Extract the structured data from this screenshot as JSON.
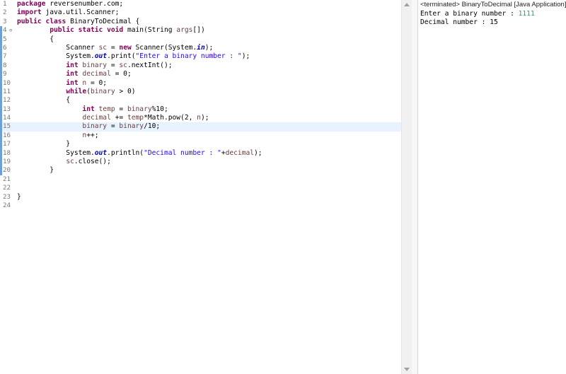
{
  "editor": {
    "lines": [
      {
        "n": "1",
        "tokens": [
          {
            "t": "kw",
            "v": "package"
          },
          {
            "t": "p",
            "v": " reversenumber.com;"
          }
        ]
      },
      {
        "n": "2",
        "tokens": [
          {
            "t": "kw",
            "v": "import"
          },
          {
            "t": "p",
            "v": " java.util.Scanner;"
          }
        ]
      },
      {
        "n": "3",
        "tokens": [
          {
            "t": "kw",
            "v": "public"
          },
          {
            "t": "p",
            "v": " "
          },
          {
            "t": "kw",
            "v": "class"
          },
          {
            "t": "p",
            "v": " BinaryToDecimal {"
          }
        ]
      },
      {
        "n": "4",
        "fold": "⊖",
        "changed": true,
        "tokens": [
          {
            "t": "p",
            "v": "        "
          },
          {
            "t": "kw",
            "v": "public"
          },
          {
            "t": "p",
            "v": " "
          },
          {
            "t": "kw",
            "v": "static"
          },
          {
            "t": "p",
            "v": " "
          },
          {
            "t": "kw",
            "v": "void"
          },
          {
            "t": "p",
            "v": " main(String "
          },
          {
            "t": "var",
            "v": "args"
          },
          {
            "t": "p",
            "v": "[])"
          }
        ]
      },
      {
        "n": "5",
        "changed": true,
        "tokens": [
          {
            "t": "p",
            "v": "        {"
          }
        ]
      },
      {
        "n": "6",
        "changed": true,
        "tokens": [
          {
            "t": "p",
            "v": "            Scanner "
          },
          {
            "t": "var",
            "v": "sc"
          },
          {
            "t": "p",
            "v": " = "
          },
          {
            "t": "kw",
            "v": "new"
          },
          {
            "t": "p",
            "v": " Scanner(System."
          },
          {
            "t": "fld",
            "v": "in"
          },
          {
            "t": "p",
            "v": ");"
          }
        ]
      },
      {
        "n": "7",
        "changed": true,
        "tokens": [
          {
            "t": "p",
            "v": "            System."
          },
          {
            "t": "fld",
            "v": "out"
          },
          {
            "t": "p",
            "v": ".print("
          },
          {
            "t": "str",
            "v": "\"Enter a binary number : \""
          },
          {
            "t": "p",
            "v": ");"
          }
        ]
      },
      {
        "n": "8",
        "changed": true,
        "tokens": [
          {
            "t": "p",
            "v": "            "
          },
          {
            "t": "kw",
            "v": "int"
          },
          {
            "t": "p",
            "v": " "
          },
          {
            "t": "var",
            "v": "binary"
          },
          {
            "t": "p",
            "v": " = "
          },
          {
            "t": "var",
            "v": "sc"
          },
          {
            "t": "p",
            "v": ".nextInt();"
          }
        ]
      },
      {
        "n": "9",
        "changed": true,
        "tokens": [
          {
            "t": "p",
            "v": "            "
          },
          {
            "t": "kw",
            "v": "int"
          },
          {
            "t": "p",
            "v": " "
          },
          {
            "t": "var",
            "v": "decimal"
          },
          {
            "t": "p",
            "v": " = 0;"
          }
        ]
      },
      {
        "n": "10",
        "changed": true,
        "tokens": [
          {
            "t": "p",
            "v": "            "
          },
          {
            "t": "kw",
            "v": "int"
          },
          {
            "t": "p",
            "v": " "
          },
          {
            "t": "var",
            "v": "n"
          },
          {
            "t": "p",
            "v": " = 0;"
          }
        ]
      },
      {
        "n": "11",
        "changed": true,
        "tokens": [
          {
            "t": "p",
            "v": "            "
          },
          {
            "t": "kw",
            "v": "while"
          },
          {
            "t": "p",
            "v": "("
          },
          {
            "t": "var",
            "v": "binary"
          },
          {
            "t": "p",
            "v": " > 0)"
          }
        ]
      },
      {
        "n": "12",
        "changed": true,
        "tokens": [
          {
            "t": "p",
            "v": "            {"
          }
        ]
      },
      {
        "n": "13",
        "changed": true,
        "tokens": [
          {
            "t": "p",
            "v": "                "
          },
          {
            "t": "kw",
            "v": "int"
          },
          {
            "t": "p",
            "v": " "
          },
          {
            "t": "var",
            "v": "temp"
          },
          {
            "t": "p",
            "v": " = "
          },
          {
            "t": "var",
            "v": "binary"
          },
          {
            "t": "p",
            "v": "%10;"
          }
        ]
      },
      {
        "n": "14",
        "changed": true,
        "tokens": [
          {
            "t": "p",
            "v": "                "
          },
          {
            "t": "var",
            "v": "decimal"
          },
          {
            "t": "p",
            "v": " += "
          },
          {
            "t": "var",
            "v": "temp"
          },
          {
            "t": "p",
            "v": "*Math."
          },
          {
            "t": "p",
            "v": "pow(2, "
          },
          {
            "t": "var",
            "v": "n"
          },
          {
            "t": "p",
            "v": ");"
          }
        ]
      },
      {
        "n": "15",
        "changed": true,
        "current": true,
        "tokens": [
          {
            "t": "p",
            "v": "                "
          },
          {
            "t": "var",
            "v": "binary"
          },
          {
            "t": "p",
            "v": " = "
          },
          {
            "t": "var",
            "v": "binary"
          },
          {
            "t": "p",
            "v": "/10;"
          }
        ]
      },
      {
        "n": "16",
        "changed": true,
        "tokens": [
          {
            "t": "p",
            "v": "                "
          },
          {
            "t": "var",
            "v": "n"
          },
          {
            "t": "p",
            "v": "++;"
          }
        ]
      },
      {
        "n": "17",
        "changed": true,
        "tokens": [
          {
            "t": "p",
            "v": "            }"
          }
        ]
      },
      {
        "n": "18",
        "changed": true,
        "tokens": [
          {
            "t": "p",
            "v": "            System."
          },
          {
            "t": "fld",
            "v": "out"
          },
          {
            "t": "p",
            "v": ".println("
          },
          {
            "t": "str",
            "v": "\"Decimal number : \""
          },
          {
            "t": "p",
            "v": "+"
          },
          {
            "t": "var",
            "v": "decimal"
          },
          {
            "t": "p",
            "v": ");"
          }
        ]
      },
      {
        "n": "19",
        "changed": true,
        "tokens": [
          {
            "t": "p",
            "v": "            "
          },
          {
            "t": "var",
            "v": "sc"
          },
          {
            "t": "p",
            "v": ".close();"
          }
        ]
      },
      {
        "n": "20",
        "changed": true,
        "tokens": [
          {
            "t": "p",
            "v": "        }"
          }
        ]
      },
      {
        "n": "21",
        "tokens": []
      },
      {
        "n": "22",
        "tokens": []
      },
      {
        "n": "23",
        "tokens": [
          {
            "t": "p",
            "v": "}"
          }
        ]
      },
      {
        "n": "24",
        "tokens": []
      }
    ]
  },
  "console": {
    "title": "<terminated> BinaryToDecimal [Java Application]",
    "prompt": "Enter a binary number : ",
    "input_value": "1111",
    "result": "Decimal number : 15"
  },
  "colors": {
    "keyword": "#7f0055",
    "local_var": "#6a3e3e",
    "string": "#2a00ff",
    "static_field": "#0000c0",
    "console_input": "#1fa36b",
    "current_line": "#e8f2fe"
  }
}
